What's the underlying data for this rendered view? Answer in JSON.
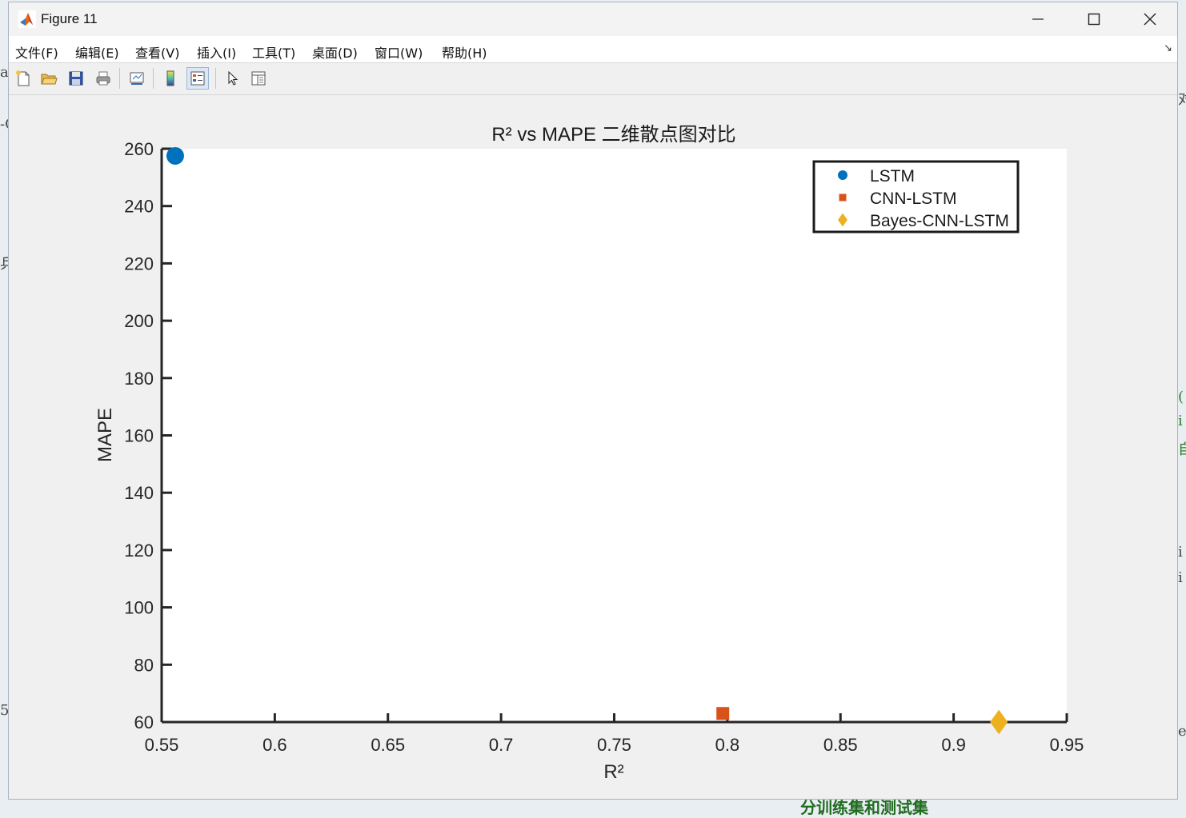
{
  "window": {
    "title": "Figure 11"
  },
  "menu": [
    "文件(F)",
    "编辑(E)",
    "查看(V)",
    "插入(I)",
    "工具(T)",
    "桌面(D)",
    "窗口(W)",
    "帮助(H)"
  ],
  "background": {
    "bottom_text": "分训练集和测试集"
  },
  "chart_data": {
    "type": "scatter",
    "title": "R² vs MAPE 二维散点图对比",
    "xlabel": "R²",
    "ylabel": "MAPE",
    "xlim": [
      0.55,
      0.95
    ],
    "ylim": [
      60,
      260
    ],
    "xticks": [
      "0.55",
      "0.6",
      "0.65",
      "0.7",
      "0.75",
      "0.8",
      "0.85",
      "0.9",
      "0.95"
    ],
    "yticks": [
      "60",
      "80",
      "100",
      "120",
      "140",
      "160",
      "180",
      "200",
      "220",
      "240",
      "260"
    ],
    "legend_position": "top-right",
    "series": [
      {
        "name": "LSTM",
        "marker": "circle",
        "color": "#0072BD",
        "x": 0.556,
        "y": 257.5
      },
      {
        "name": "CNN-LSTM",
        "marker": "square",
        "color": "#D95319",
        "x": 0.798,
        "y": 63
      },
      {
        "name": "Bayes-CNN-LSTM",
        "marker": "diamond",
        "color": "#EDB120",
        "x": 0.92,
        "y": 60
      }
    ]
  }
}
